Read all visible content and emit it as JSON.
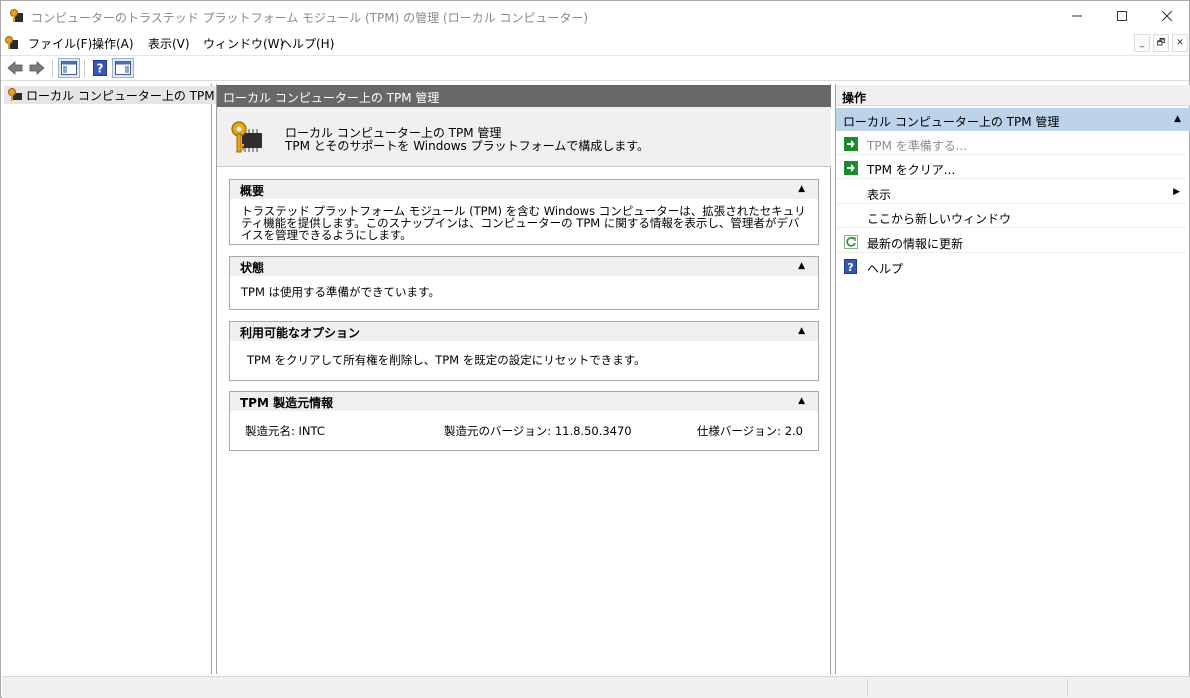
{
  "window": {
    "title": "コンピューターのトラステッド プラットフォーム モジュール (TPM) の管理 (ローカル コンピューター)",
    "minimize_symbol": "—",
    "maximize_symbol": "☐",
    "close_symbol": "✕"
  },
  "menubar": {
    "items": [
      "ファイル(F)",
      "操作(A)",
      "表示(V)",
      "ウィンドウ(W)",
      "ヘルプ(H)"
    ],
    "mdi_minimize": "_",
    "mdi_restore": "🗗",
    "mdi_close": "✕"
  },
  "toolbar": {
    "icons": [
      "back-icon",
      "forward-icon",
      "show-hide-console-tree-icon",
      "help-icon",
      "show-hide-action-pane-icon"
    ]
  },
  "tree": {
    "root_label": "ローカル コンピューター上の TPM 管理"
  },
  "center": {
    "header": "ローカル コンピューター上の TPM 管理",
    "info_line1": "ローカル コンピューター上の TPM 管理",
    "info_line2": "TPM とそのサポートを Windows プラットフォームで構成します。",
    "sections": {
      "overview": {
        "title": "概要",
        "body": "トラステッド プラットフォーム モジュール (TPM) を含む Windows コンピューターは、拡張されたセキュリティ機能を提供します。このスナップインは、コンピューターの TPM に関する情報を表示し、管理者がデバイスを管理できるようにします。"
      },
      "status": {
        "title": "状態",
        "body": "TPM は使用する準備ができています。"
      },
      "options": {
        "title": "利用可能なオプション",
        "body": "TPM をクリアして所有権を削除し、TPM を既定の設定にリセットできます。"
      },
      "manufacturer": {
        "title": "TPM 製造元情報",
        "name_label": "製造元名:",
        "name_value": "INTC",
        "version_label": "製造元のバージョン:",
        "version_value": "11.8.50.3470",
        "spec_label": "仕様バージョン:",
        "spec_value": "2.0"
      }
    }
  },
  "actions": {
    "header": "操作",
    "group": "ローカル コンピューター上の TPM 管理",
    "items": [
      {
        "label": "TPM を準備する...",
        "icon": "run-action-icon",
        "enabled": false
      },
      {
        "label": "TPM をクリア...",
        "icon": "run-action-icon",
        "enabled": true
      },
      {
        "label": "表示",
        "icon": "",
        "enabled": true
      },
      {
        "label": "ここから新しいウィンドウ",
        "icon": "",
        "enabled": true
      },
      {
        "label": "最新の情報に更新",
        "icon": "refresh-icon",
        "enabled": true
      },
      {
        "label": "ヘルプ",
        "icon": "help-icon",
        "enabled": true
      }
    ]
  },
  "colors": {
    "center_header_bg": "#686868",
    "action_group_bg": "#bcd3ea",
    "run_icon_green": "#1f8a2e",
    "help_icon_blue": "#3557b7"
  }
}
